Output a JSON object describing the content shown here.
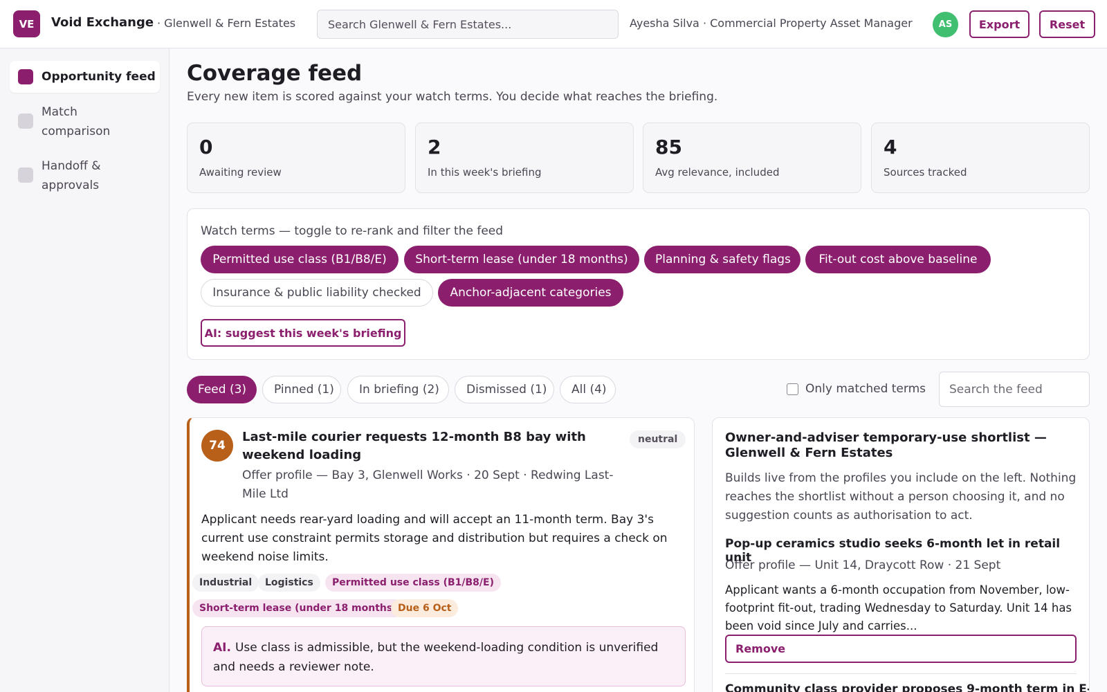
{
  "header": {
    "logo_initials": "VE",
    "app_name": "Void Exchange",
    "org": "· Glenwell & Fern Estates",
    "search_placeholder": "Search Glenwell & Fern Estates...",
    "user": "Ayesha Silva · Commercial Property Asset Manager",
    "avatar_initials": "AS",
    "export_label": "Export",
    "reset_label": "Reset"
  },
  "sidebar": {
    "items": [
      {
        "label": "Opportunity feed",
        "active": true
      },
      {
        "label": "Match comparison",
        "active": false
      },
      {
        "label": "Handoff & approvals",
        "active": false
      }
    ]
  },
  "main": {
    "title": "Coverage feed",
    "subtitle": "Every new item is scored against your watch terms. You decide what reaches the briefing.",
    "stats": [
      {
        "value": "0",
        "label": "Awaiting review"
      },
      {
        "value": "2",
        "label": "In this week's briefing"
      },
      {
        "value": "85",
        "label": "Avg relevance, included"
      },
      {
        "value": "4",
        "label": "Sources tracked"
      }
    ]
  },
  "watch": {
    "title": "Watch terms — toggle to re-rank and filter the feed",
    "terms": [
      {
        "label": "Permitted use class (B1/B8/E)",
        "on": true
      },
      {
        "label": "Short-term lease (under 18 months)",
        "on": true
      },
      {
        "label": "Planning & safety flags",
        "on": true
      },
      {
        "label": "Fit-out cost above baseline",
        "on": true
      },
      {
        "label": "Insurance & public liability checked",
        "on": false
      },
      {
        "label": "Anchor-adjacent categories",
        "on": true
      }
    ],
    "ai_suggest_label": "AI: suggest this week's briefing"
  },
  "tabs": [
    {
      "label": "Feed (3)",
      "active": true
    },
    {
      "label": "Pinned (1)",
      "active": false
    },
    {
      "label": "In briefing (2)",
      "active": false
    },
    {
      "label": "Dismissed (1)",
      "active": false
    },
    {
      "label": "All (4)",
      "active": false
    }
  ],
  "filters": {
    "only_matched_label": "Only matched terms",
    "only_matched_checked": false,
    "search_placeholder": "Search the feed"
  },
  "feed_card": {
    "score": "74",
    "title": "Last-mile courier requests 12-month B8 bay with weekend loading",
    "sentiment": "neutral",
    "meta": "Offer profile — Bay 3, Glenwell Works · 20 Sept · Redwing Last-Mile Ltd",
    "body": "Applicant needs rear-yard loading and will accept an 11-month term. Bay 3's current use constraint permits storage and distribution but requires a check on weekend noise limits.",
    "tags": {
      "industrial": "Industrial",
      "logistics": "Logistics",
      "term1": "Permitted use class (B1/B8/E)",
      "term2": "Short-term lease (under 18 months)",
      "due": "Due 6 Oct"
    },
    "ai_label": "AI.",
    "ai_text": "Use class is admissible, but the weekend-loading condition is unverified and needs a reviewer note.",
    "accent": "#b8601a"
  },
  "shortlist": {
    "title": "Owner-and-adviser temporary-use shortlist — Glenwell & Fern Estates",
    "description": "Builds live from the profiles you include on the left. Nothing reaches the shortlist without a person choosing it, and no suggestion counts as authorisation to act.",
    "items": [
      {
        "title": "Pop-up ceramics studio seeks 6-month let in retail unit",
        "meta": "Offer profile — Unit 14, Draycott Row · 21 Sept",
        "body": "Applicant wants a 6-month occupation from November, low-footprint fit-out, trading Wednesday to Saturday. Unit 14 has been void since July and carries...",
        "remove_label": "Remove"
      },
      {
        "title": "Community class provider proposes 9-month term in E-"
      }
    ]
  },
  "colors": {
    "brand": "#8b1f6e",
    "score_amber": "#b8601a",
    "avatar_green": "#3fbf6f"
  }
}
